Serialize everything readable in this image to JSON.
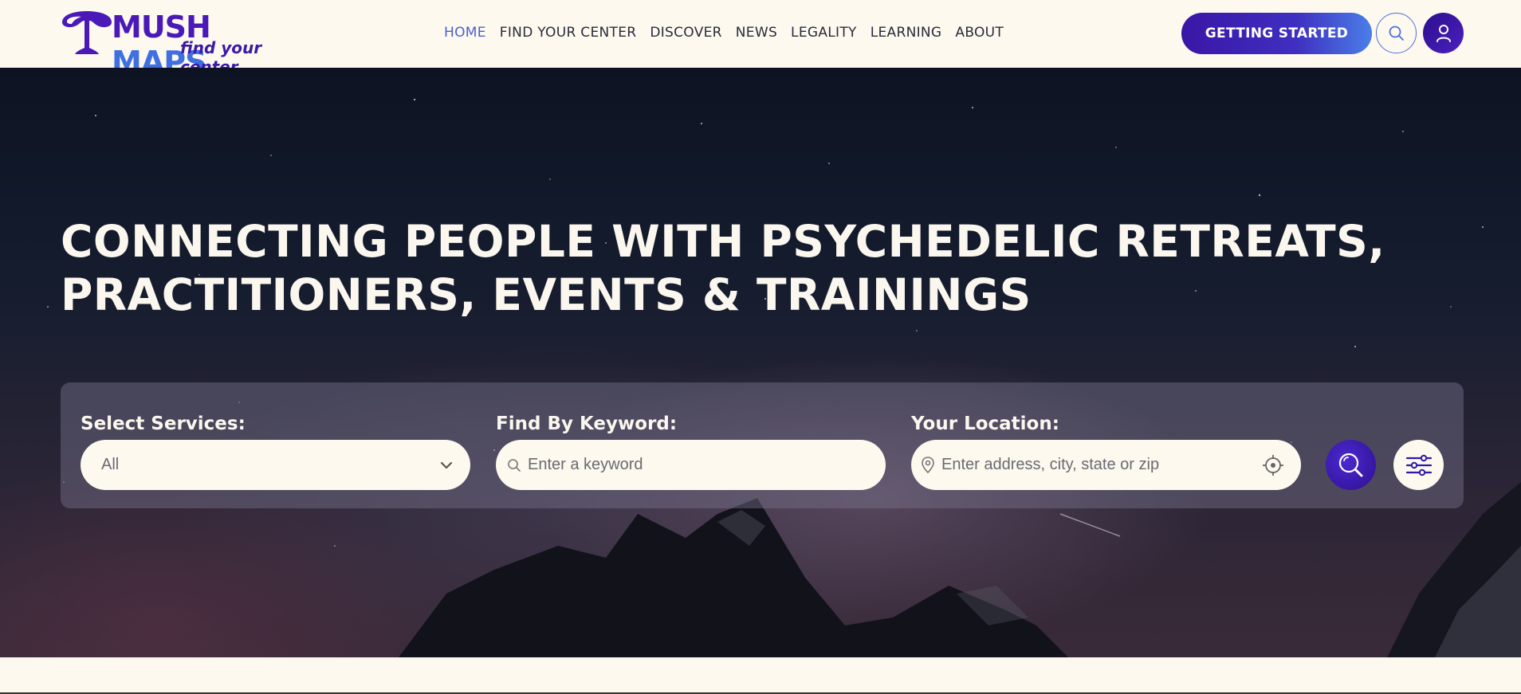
{
  "brand": {
    "name_part1": "MUSH",
    "name_part2": "MAPS",
    "tagline": "find your center",
    "logo_icon": "mushroom-logo-icon"
  },
  "nav": {
    "items": [
      {
        "label": "HOME",
        "active": true
      },
      {
        "label": "FIND YOUR CENTER",
        "active": false
      },
      {
        "label": "DISCOVER",
        "active": false
      },
      {
        "label": "NEWS",
        "active": false
      },
      {
        "label": "LEGALITY",
        "active": false
      },
      {
        "label": "LEARNING",
        "active": false
      },
      {
        "label": "ABOUT",
        "active": false
      }
    ]
  },
  "header_actions": {
    "cta_label": "GETTING STARTED",
    "search_icon": "search-icon",
    "user_icon": "user-icon"
  },
  "hero": {
    "title_line1": "CONNECTING PEOPLE WITH PSYCHEDELIC RETREATS,",
    "title_line2": "PRACTITIONERS, EVENTS & TRAININGS"
  },
  "search": {
    "services_label": "Select Services:",
    "services_value": "All",
    "keyword_label": "Find By Keyword:",
    "keyword_placeholder": "Enter a keyword",
    "location_label": "Your Location:",
    "location_placeholder": "Enter address, city, state or zip",
    "submit_icon": "search-icon",
    "filters_icon": "sliders-icon",
    "locate_icon": "crosshair-icon",
    "pin_icon": "map-pin-icon",
    "dropdown_icon": "chevron-down-icon"
  },
  "colors": {
    "brand_purple": "#4a19b8",
    "brand_blue": "#3f6fe0",
    "background_cream": "#fdf9ef",
    "nav_active": "#4b5fcf"
  }
}
